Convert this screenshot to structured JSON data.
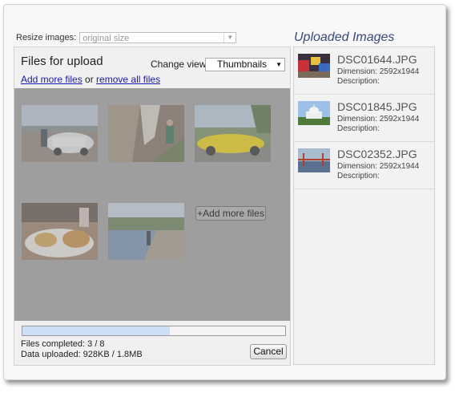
{
  "resize": {
    "label": "Resize images:",
    "value": "original size"
  },
  "upload": {
    "title": "Files for upload",
    "change_view_label": "Change view:",
    "view_value": "Thumbnails",
    "add_more_link": "Add more files",
    "or_text": " or ",
    "remove_all_link": "remove all files",
    "add_more_button": "+Add more files",
    "progress_fraction": 0.56,
    "files_completed": "Files completed: 3 / 8",
    "data_uploaded": "Data uploaded: 928KB / 1.8MB",
    "cancel_label": "Cancel"
  },
  "uploaded": {
    "title": "Uploaded Images",
    "items": [
      {
        "name": "DSC01644.JPG",
        "dimension": "Dimension: 2592x1944",
        "description": "Description:"
      },
      {
        "name": "DSC01845.JPG",
        "dimension": "Dimension: 2592x1944",
        "description": "Description:"
      },
      {
        "name": "DSC02352.JPG",
        "dimension": "Dimension: 2592x1944",
        "description": "Description:"
      }
    ]
  }
}
